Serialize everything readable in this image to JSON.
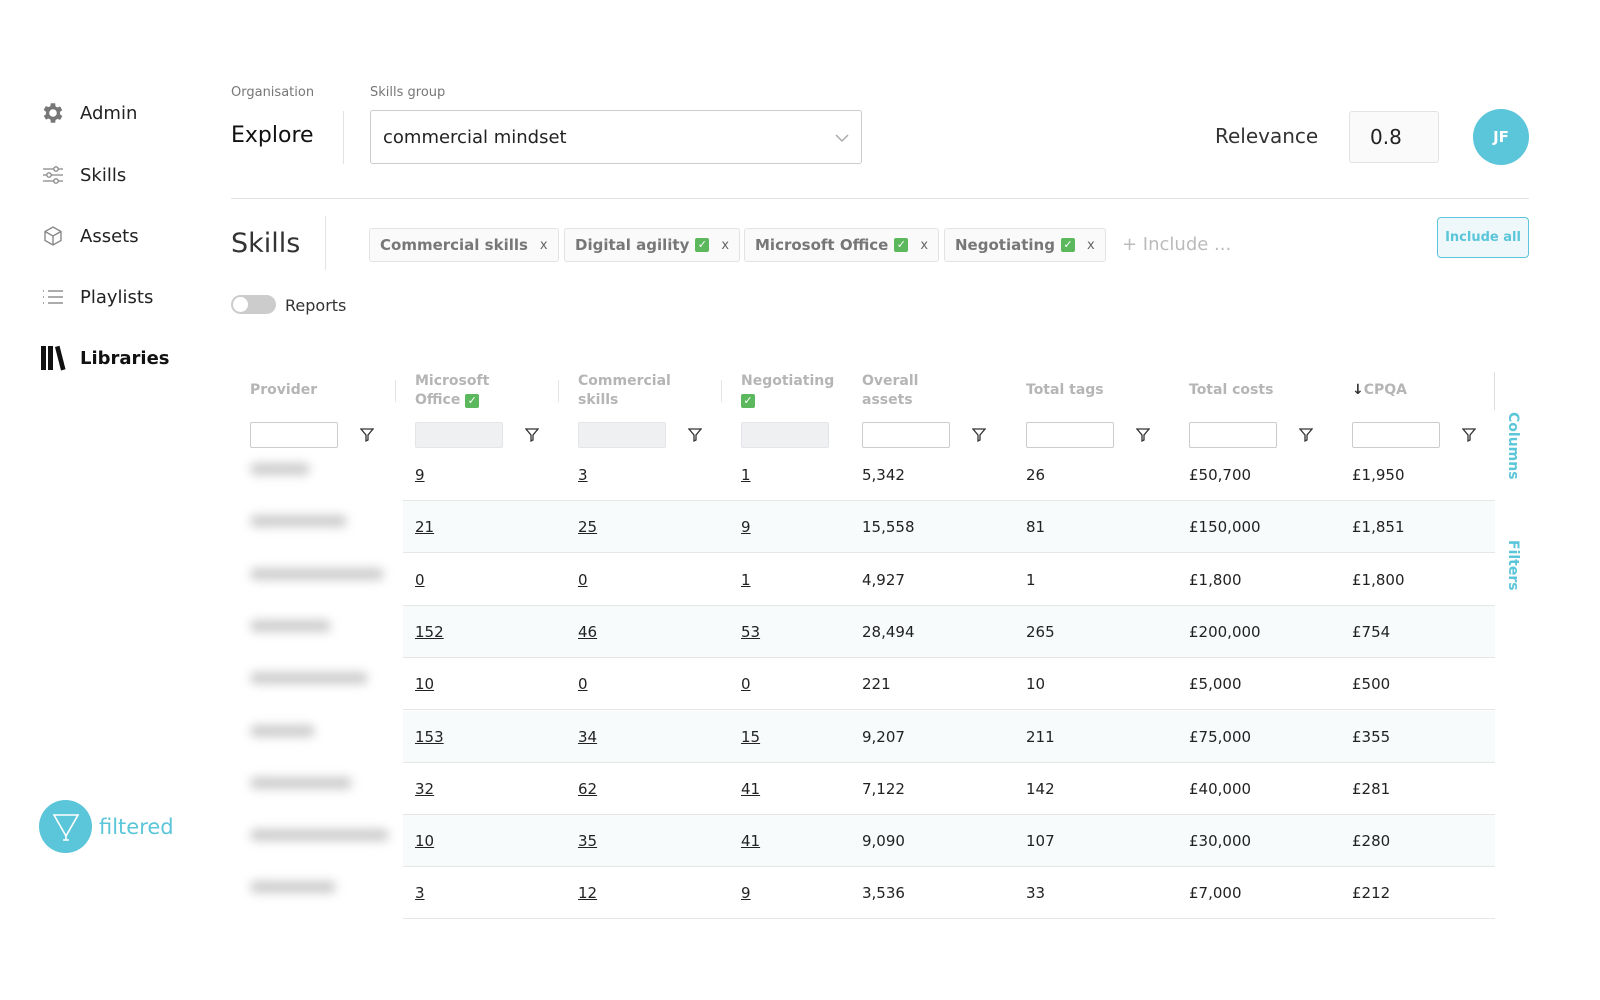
{
  "sidebar": {
    "items": [
      {
        "label": "Admin",
        "icon": "gear-icon"
      },
      {
        "label": "Skills",
        "icon": "sliders-icon"
      },
      {
        "label": "Assets",
        "icon": "cube-icon"
      },
      {
        "label": "Playlists",
        "icon": "list-icon"
      },
      {
        "label": "Libraries",
        "icon": "books-icon",
        "active": true
      }
    ],
    "logo_text": "filtered"
  },
  "header": {
    "organisation_label": "Organisation",
    "organisation_value": "Explore",
    "skills_group_label": "Skills group",
    "skills_group_value": "commercial mindset",
    "relevance_label": "Relevance",
    "relevance_value": "0.8",
    "avatar_initials": "JF"
  },
  "skills": {
    "title": "Skills",
    "chips": [
      {
        "label": "Commercial skills",
        "checked": false
      },
      {
        "label": "Digital agility",
        "checked": true
      },
      {
        "label": "Microsoft Office",
        "checked": true
      },
      {
        "label": "Negotiating",
        "checked": true
      }
    ],
    "remove_glyph": "x",
    "include_placeholder": "+ Include ...",
    "include_all_label": "Include all",
    "reports_label": "Reports",
    "reports_on": false
  },
  "table": {
    "headers": [
      "Provider",
      "Microsoft Office",
      "Commercial skills",
      "Negotiating",
      "Overall assets",
      "Total tags",
      "Total costs",
      "CPQA"
    ],
    "sort_indicator": "↓",
    "rows": [
      [
        "9",
        "3",
        "1",
        "5,342",
        "26",
        "£50,700",
        "£1,950"
      ],
      [
        "21",
        "25",
        "9",
        "15,558",
        "81",
        "£150,000",
        "£1,851"
      ],
      [
        "0",
        "0",
        "1",
        "4,927",
        "1",
        "£1,800",
        "£1,800"
      ],
      [
        "152",
        "46",
        "53",
        "28,494",
        "265",
        "£200,000",
        "£754"
      ],
      [
        "10",
        "0",
        "0",
        "221",
        "10",
        "£5,000",
        "£500"
      ],
      [
        "153",
        "34",
        "15",
        "9,207",
        "211",
        "£75,000",
        "£355"
      ],
      [
        "32",
        "62",
        "41",
        "7,122",
        "142",
        "£40,000",
        "£281"
      ],
      [
        "10",
        "35",
        "41",
        "9,090",
        "107",
        "£30,000",
        "£280"
      ],
      [
        "3",
        "12",
        "9",
        "3,536",
        "33",
        "£7,000",
        "£212"
      ]
    ]
  },
  "side_tabs": {
    "columns": "Columns",
    "filters": "Filters"
  },
  "colors": {
    "accent": "#5bc5d9",
    "check": "#5cb85c"
  }
}
